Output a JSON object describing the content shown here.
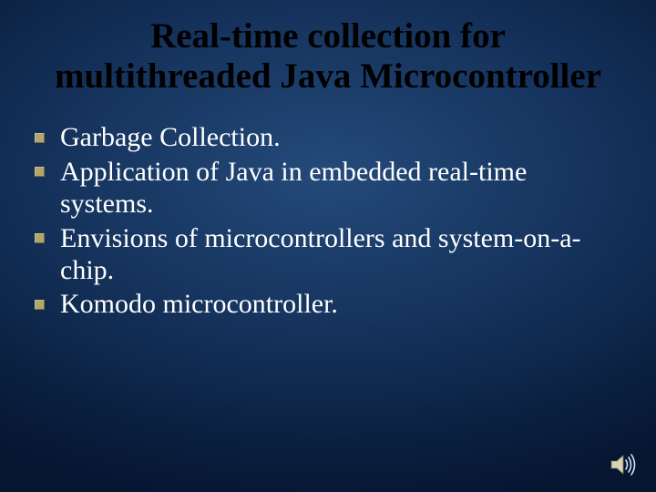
{
  "title_line1": "Real-time collection for",
  "title_line2": "multithreaded Java Microcontroller",
  "bullets": [
    "Garbage Collection.",
    "Application of Java in embedded real-time systems.",
    "Envisions of microcontrollers and system-on-a-chip.",
    "Komodo microcontroller."
  ]
}
